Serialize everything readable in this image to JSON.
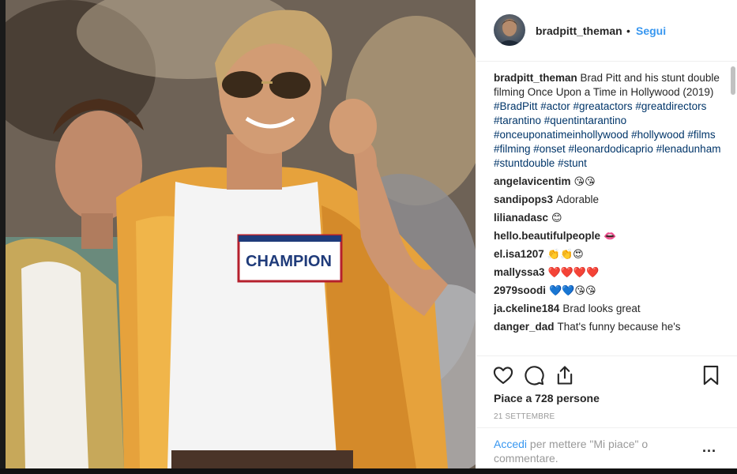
{
  "post": {
    "username": "bradpitt_theman",
    "dot": "•",
    "follow_label": "Segui",
    "photo_shirt_text": "CHAMPION"
  },
  "caption": {
    "username": "bradpitt_theman",
    "text": "Brad Pitt and his stunt double filming Once Upon a Time in Hollywood (2019)",
    "hashtags": "#BradPitt #actor #greatactors #greatdirectors #tarantino #quentintarantino #onceuponatimeinhollywood #hollywood #films #filming #onset #leonardodicaprio #lenadunham #stuntdouble #stunt"
  },
  "comments": [
    {
      "user": "angelavicentim",
      "text": "",
      "emoji": "😘😘"
    },
    {
      "user": "sandipops3",
      "text": "Adorable",
      "emoji": ""
    },
    {
      "user": "lilianadasc",
      "text": "",
      "emoji": "😊"
    },
    {
      "user": "hello.beautifulpeople",
      "text": "",
      "emoji": "👄"
    },
    {
      "user": "el.isa1207",
      "text": "",
      "emoji": "👏👏😍"
    },
    {
      "user": "mallyssa3",
      "text": "",
      "emoji": "❤️❤️❤️❤️"
    },
    {
      "user": "2979soodi",
      "text": "",
      "emoji": "💙💙😘😘"
    },
    {
      "user": "ja.ckeline184",
      "text": "Brad looks great",
      "emoji": ""
    },
    {
      "user": "danger_dad",
      "text": "That's funny because he's",
      "emoji": ""
    }
  ],
  "actions": {
    "likes_text": "Piace a 728 persone",
    "date": "21 SETTEMBRE",
    "login_link": "Accedi",
    "login_text": " per mettere \"Mi piace\" o commentare.",
    "more": "..."
  },
  "icons": {
    "like": "heart-icon",
    "comment": "comment-icon",
    "share": "share-icon",
    "save": "bookmark-icon"
  },
  "colors": {
    "link_blue": "#3897f0",
    "hashtag": "#003569",
    "muted": "#999999"
  }
}
